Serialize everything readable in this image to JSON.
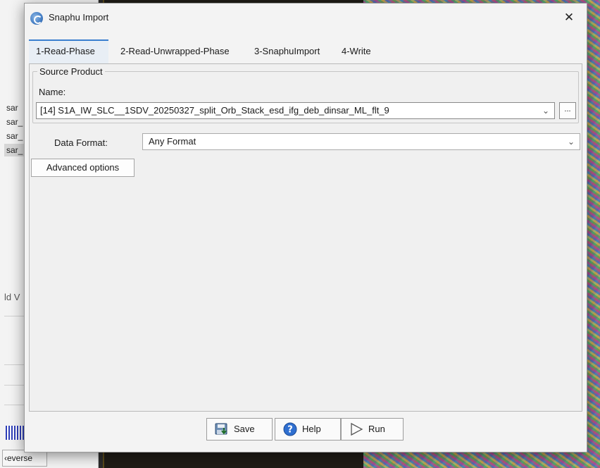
{
  "background": {
    "list_items": [
      "sar",
      "sar_",
      "sar_",
      "sar_"
    ],
    "side_label": "ld V",
    "reverse_button": "‹everse"
  },
  "dialog": {
    "title": "Snaphu Import",
    "close_symbol": "✕",
    "tabs": [
      {
        "label": "1-Read-Phase",
        "active": true
      },
      {
        "label": "2-Read-Unwrapped-Phase",
        "active": false
      },
      {
        "label": "3-SnaphuImport",
        "active": false
      },
      {
        "label": "4-Write",
        "active": false
      }
    ],
    "source_product": {
      "legend": "Source Product",
      "name_label": "Name:",
      "selected": "[14] S1A_IW_SLC__1SDV_20250327_split_Orb_Stack_esd_ifg_deb_dinsar_ML_flt_9",
      "browse_label": "..."
    },
    "data_format": {
      "label": "Data Format:",
      "selected": "Any Format"
    },
    "advanced_label": "Advanced options",
    "footer": {
      "save": "Save",
      "help": "Help",
      "run": "Run"
    }
  },
  "colors": {
    "accent": "#3a7fcf",
    "tab_active_bg": "#e8eef5"
  }
}
